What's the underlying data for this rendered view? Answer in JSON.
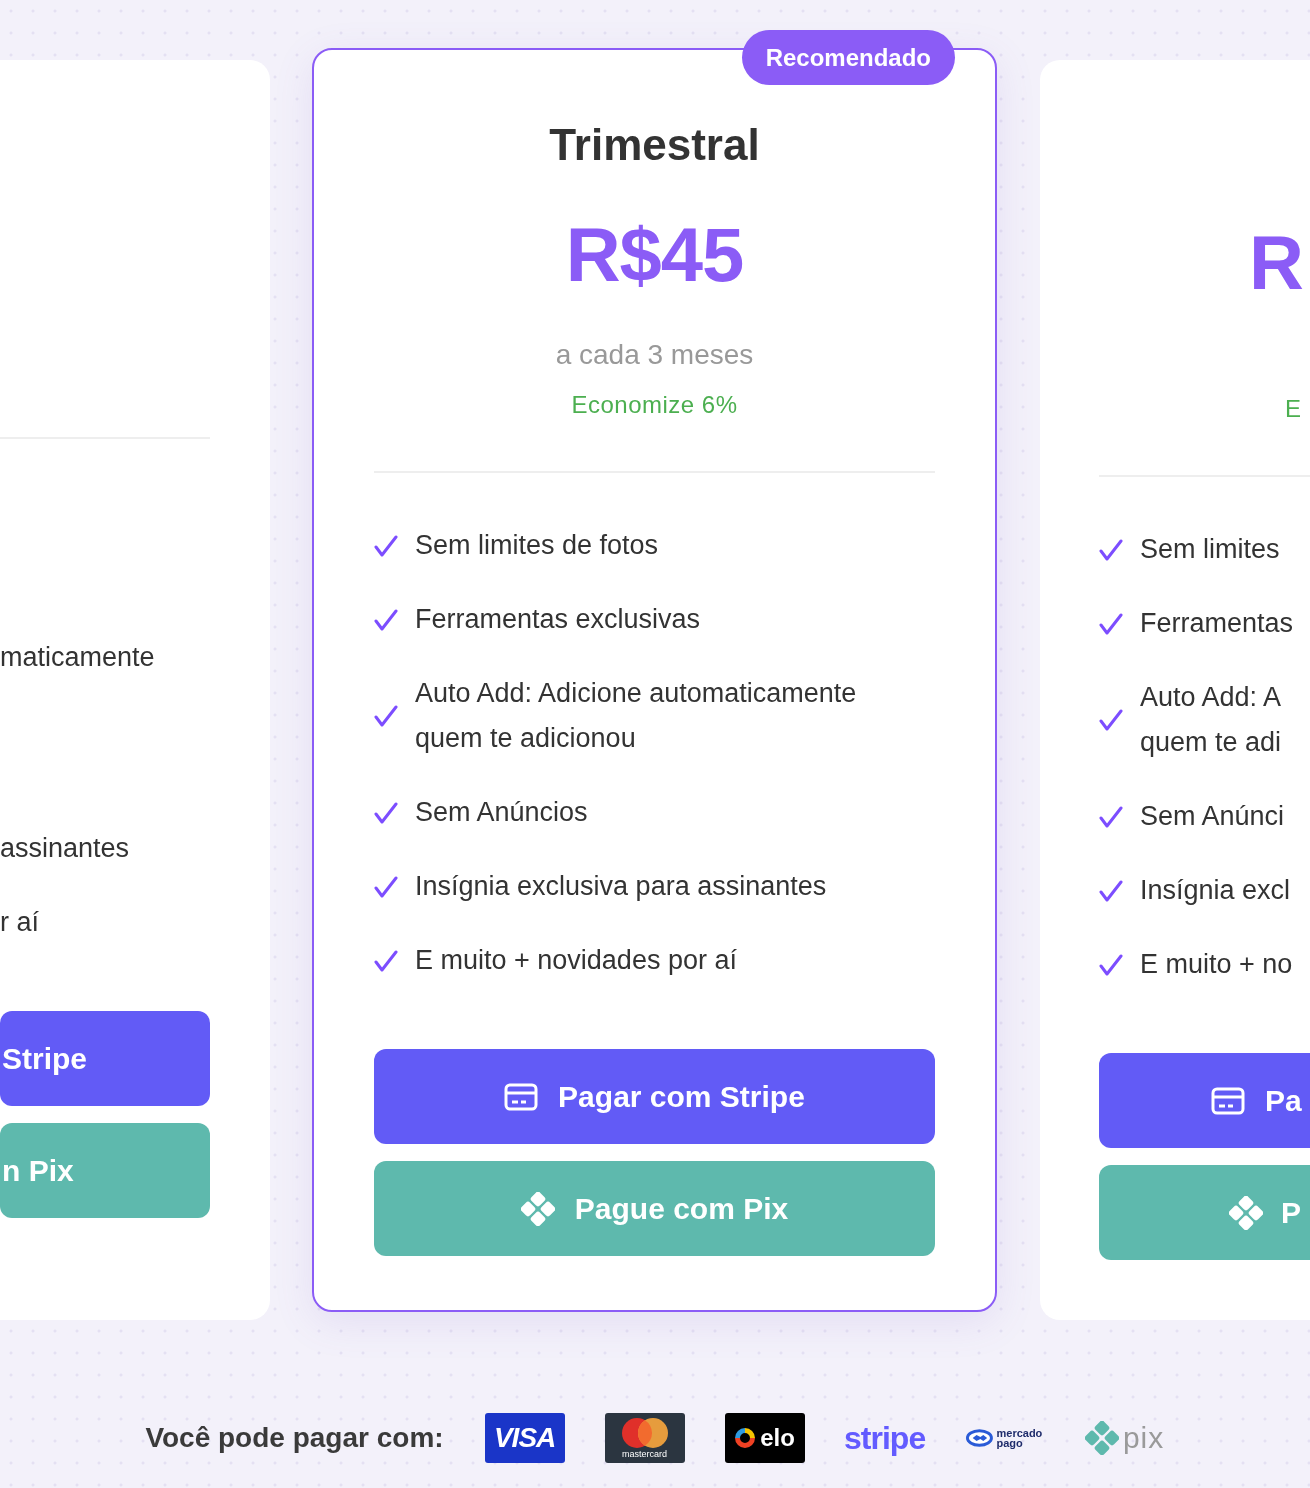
{
  "plans": [
    {
      "kind": "partial-left",
      "features": [
        {
          "lines": [
            "maticamente"
          ]
        },
        {
          "lines": [
            "assinantes"
          ]
        },
        {
          "lines": [
            "r aí"
          ]
        }
      ],
      "buttons": [
        {
          "kind": "stripe",
          "label": "Stripe",
          "icon": false
        },
        {
          "kind": "pix",
          "label": "n Pix",
          "icon": false
        }
      ]
    },
    {
      "kind": "featured",
      "badge": "Recomendado",
      "title": "Trimestral",
      "price": "R$45",
      "period": "a cada 3 meses",
      "savings": "Economize 6%",
      "features": [
        {
          "lines": [
            "Sem limites de fotos"
          ]
        },
        {
          "lines": [
            "Ferramentas exclusivas"
          ]
        },
        {
          "lines": [
            "Auto Add: Adicione automaticamente",
            "quem te adicionou"
          ]
        },
        {
          "lines": [
            "Sem Anúncios"
          ]
        },
        {
          "lines": [
            "Insígnia exclusiva para assinantes"
          ]
        },
        {
          "lines": [
            "E muito + novidades por aí"
          ]
        }
      ],
      "buttons": [
        {
          "kind": "stripe",
          "label": "Pagar com Stripe",
          "icon": true
        },
        {
          "kind": "pix",
          "label": "Pague com Pix",
          "icon": true
        }
      ]
    },
    {
      "kind": "partial-right",
      "price": "R",
      "savings": "E",
      "features": [
        {
          "lines": [
            "Sem limites"
          ]
        },
        {
          "lines": [
            "Ferramentas"
          ]
        },
        {
          "lines": [
            "Auto Add: A",
            "quem te adi"
          ]
        },
        {
          "lines": [
            "Sem Anúnci"
          ]
        },
        {
          "lines": [
            "Insígnia excl"
          ]
        },
        {
          "lines": [
            "E muito + no"
          ]
        }
      ],
      "buttons": [
        {
          "kind": "stripe",
          "label": "Pa",
          "icon": true
        },
        {
          "kind": "pix",
          "label": "P",
          "icon": true
        }
      ]
    }
  ],
  "payment_methods": {
    "label": "Você pode pagar com:",
    "logos": [
      {
        "kind": "visa",
        "text": "VISA"
      },
      {
        "kind": "mastercard",
        "text": "mastercard"
      },
      {
        "kind": "elo",
        "text": "elo"
      },
      {
        "kind": "stripe",
        "text": "stripe"
      },
      {
        "kind": "mercadopago",
        "text": "mercado pago"
      },
      {
        "kind": "pix",
        "text": "pix"
      }
    ]
  }
}
